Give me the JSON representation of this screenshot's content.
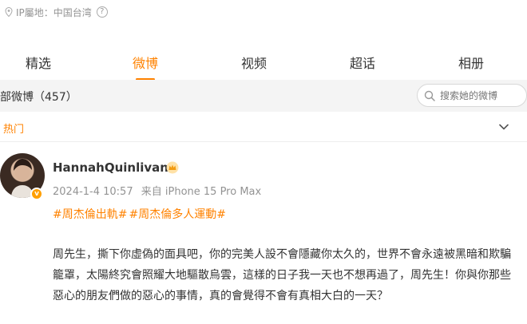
{
  "ip_row": {
    "label": "IP屬地：中国台湾"
  },
  "tabs": [
    {
      "label": "精选",
      "active": false
    },
    {
      "label": "微博",
      "active": true
    },
    {
      "label": "视频",
      "active": false
    },
    {
      "label": "超话",
      "active": false
    },
    {
      "label": "相册",
      "active": false
    }
  ],
  "filter": {
    "title": "部微博（457）",
    "search_placeholder": "搜索她的微博"
  },
  "hot": {
    "label": "热门"
  },
  "post": {
    "username": "HannahQuinlivan",
    "date": "2024-1-4 10:57",
    "source": "来自 iPhone 15 Pro Max",
    "tags": [
      "#周杰倫出軌#",
      "#周杰倫多人運動#"
    ],
    "content": "周先生，撕下你虛偽的面具吧，你的完美人設不會隱藏你太久的，世界不會永遠被黑暗和欺騙籠罩，太陽終究會照耀大地驅散烏雲，這樣的日子我一天也不想再過了，周先生！你與你那些惡心的朋友們做的惡心的事情，真的會覺得不會有真相大白的一天？"
  },
  "colors": {
    "accent": "#ff8200",
    "muted": "#939393",
    "filter_bg": "#f4f4f4"
  },
  "icons": {
    "ip": "location-icon",
    "help": "question-icon",
    "search": "search-icon",
    "collapse": "chevron-down-icon",
    "vip": "crown-icon",
    "verified": "verified-badge-icon"
  }
}
